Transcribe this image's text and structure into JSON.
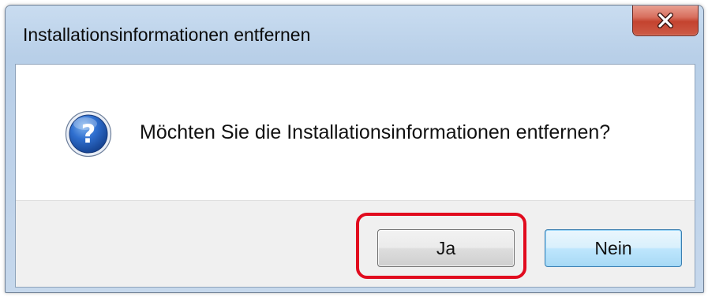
{
  "window": {
    "title": "Installationsinformationen entfernen",
    "close_label": "X"
  },
  "dialog": {
    "icon": "question-icon",
    "message": "Möchten Sie die Installationsinformationen entfernen?"
  },
  "buttons": {
    "yes_label": "Ja",
    "no_label": "Nein"
  },
  "annotation": {
    "highlight_color": "#e10b1e",
    "highlighted_button": "Ja"
  }
}
